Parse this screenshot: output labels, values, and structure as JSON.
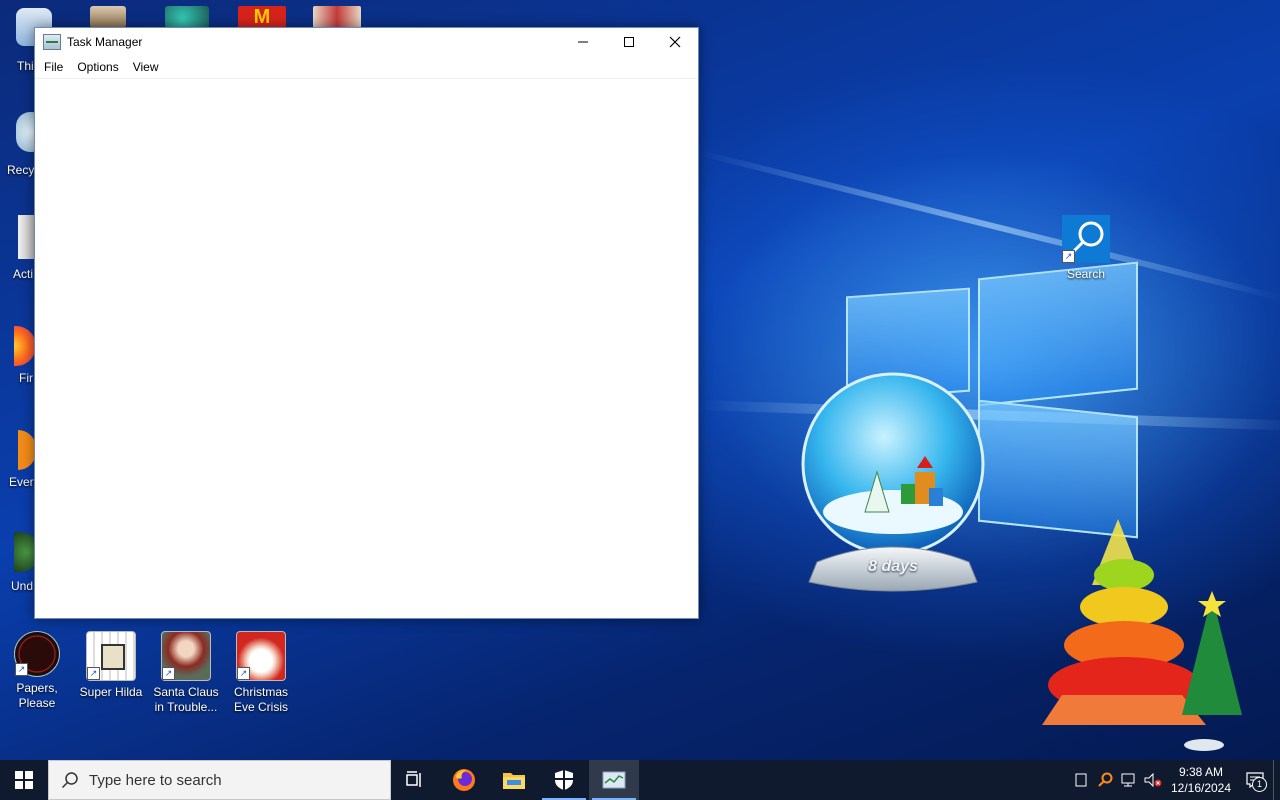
{
  "task_manager": {
    "title": "Task Manager",
    "menu": [
      "File",
      "Options",
      "View"
    ],
    "controls": {
      "minimize": "—",
      "maximize": "☐",
      "close": "✕"
    }
  },
  "desktop": {
    "left_edge_labels": [
      "Thi",
      "Recy",
      "Acti",
      "Fir",
      "Every",
      "Und"
    ],
    "bottom_icons": [
      {
        "label": "Papers,\nPlease"
      },
      {
        "label": "Super Hilda"
      },
      {
        "label": "Santa Claus\nin Trouble..."
      },
      {
        "label": "Christmas\nEve Crisis"
      }
    ],
    "search_icon_label": "Search",
    "snow_globe_text": "8 days"
  },
  "taskbar": {
    "search_placeholder": "Type here to search",
    "time": "9:38 AM",
    "date": "12/16/2024",
    "notification_count": "1"
  }
}
